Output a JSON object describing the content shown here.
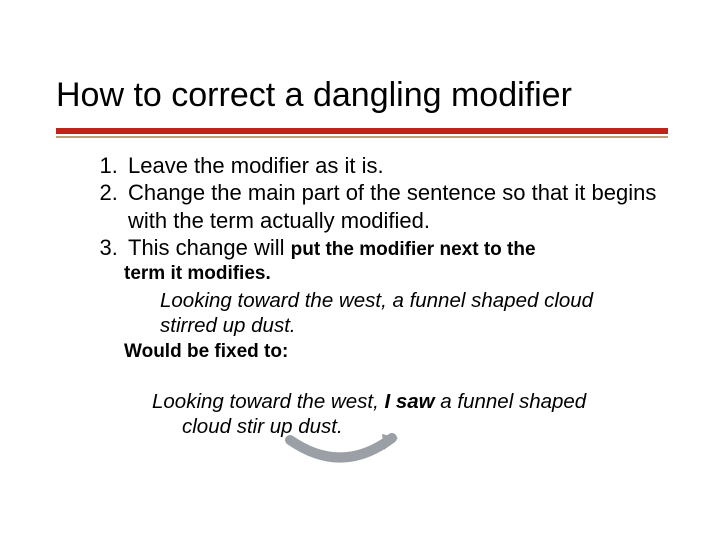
{
  "title": "How to correct a dangling modifier",
  "points": {
    "p1": "Leave the modifier as it is.",
    "p2": "Change the main part of the sentence so that it begins with the term actually modified.",
    "p3_lead": "This change will ",
    "p3_tail": "put the modifier next to the"
  },
  "term_modifies": "term it modifies.",
  "example1": "Looking toward the west, a funnel shaped cloud stirred up dust.",
  "fixed_label": "Would be fixed to:",
  "example2_a": "Looking toward the west, ",
  "example2_isaw": "I saw",
  "example2_b": " a funnel shaped cloud stir up dust."
}
